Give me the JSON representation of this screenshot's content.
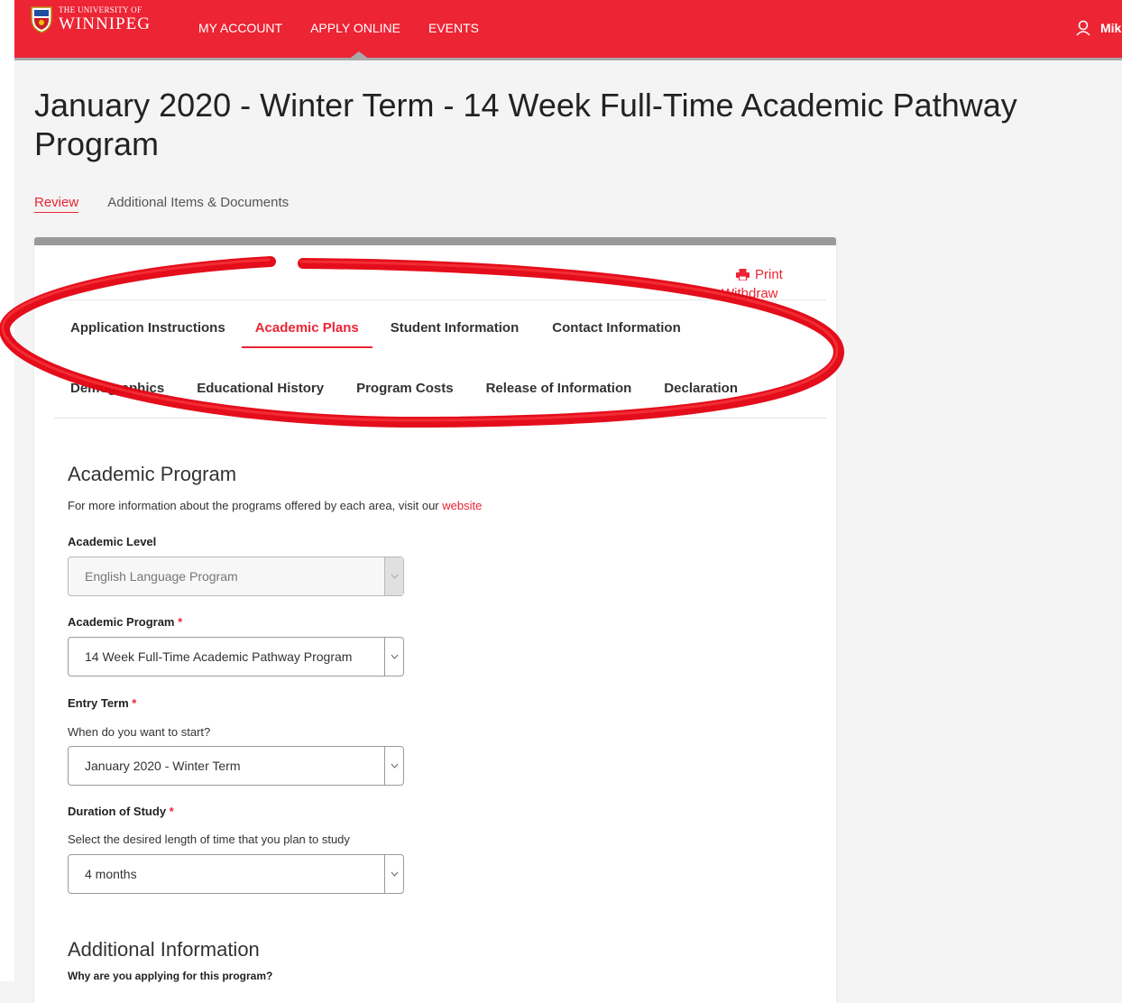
{
  "header": {
    "logo_small": "THE UNIVERSITY OF",
    "logo_big": "WINNIPEG",
    "nav": [
      "MY ACCOUNT",
      "APPLY ONLINE",
      "EVENTS"
    ],
    "user_name": "Mike",
    "brand_color": "#ec2434"
  },
  "page": {
    "title": "January 2020 - Winter Term - 14 Week Full-Time Academic Pathway Program"
  },
  "subtabs": [
    "Review",
    "Additional Items & Documents"
  ],
  "card": {
    "print_label": "Print",
    "withdraw_label": "Withdraw",
    "tabs_row1": [
      "Application Instructions",
      "Academic Plans",
      "Student Information",
      "Contact Information"
    ],
    "tabs_row2": [
      "Demographics",
      "Educational History",
      "Program Costs",
      "Release of Information",
      "Declaration"
    ]
  },
  "academic_program": {
    "title": "Academic Program",
    "info_text": "For more information about the programs offered by each area, visit our",
    "info_link": "website",
    "level_label": "Academic Level",
    "level_value": "English Language Program",
    "program_label": "Academic Program",
    "program_value": "14 Week Full-Time Academic Pathway Program",
    "entry_label": "Entry Term",
    "entry_help": "When do you want to start?",
    "entry_value": "January 2020 - Winter Term",
    "duration_label": "Duration of Study",
    "duration_help": "Select the desired length of time that you plan to study",
    "duration_value": "4 months",
    "required_mark": "*"
  },
  "additional_info": {
    "title": "Additional Information",
    "question": "Why are you applying for this program?"
  }
}
